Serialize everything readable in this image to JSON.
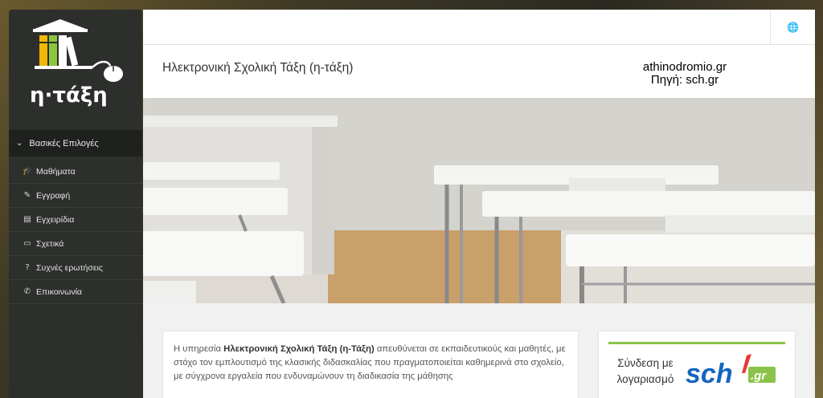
{
  "sidebar": {
    "logo_text": "η·τάξη",
    "menu_header": "Βασικές Επιλογές",
    "items": [
      {
        "label": "Μαθήματα",
        "icon": "graduation-cap-icon",
        "glyph": "🎓"
      },
      {
        "label": "Εγγραφή",
        "icon": "edit-icon",
        "glyph": "✎"
      },
      {
        "label": "Εγχειρίδια",
        "icon": "document-icon",
        "glyph": "▤"
      },
      {
        "label": "Σχετικά",
        "icon": "credit-card-icon",
        "glyph": "▭"
      },
      {
        "label": "Συχνές ερωτήσεις",
        "icon": "question-circle-icon",
        "glyph": "?"
      },
      {
        "label": "Επικοινωνία",
        "icon": "phone-icon",
        "glyph": "✆"
      }
    ]
  },
  "header": {
    "title": "Ηλεκτρονική Σχολική Τάξη (η-τάξη)",
    "watermark_line1": "athinodromio.gr",
    "watermark_line2": "Πηγή: sch.gr"
  },
  "info": {
    "pre": "Η υπηρεσία ",
    "bold": "Ηλεκτρονική Σχολική Τάξη (η-Τάξη)",
    "post": " απευθύνεται σε εκπαιδευτικούς και μαθητές, με στόχο τον εμπλουτισμό της κλασικής διδασκαλίας που πραγματοποιείται καθημερινά στο σχολείο, με σύγχρονα εργαλεία που ενδυναμώνουν τη διαδικασία της μάθησης"
  },
  "login": {
    "line1": "Σύνδεση με",
    "line2": "λογαριασμό",
    "logo_main": "sch",
    "logo_suffix": ".gr"
  },
  "colors": {
    "sidebar_bg": "#2c2f2c",
    "accent_green": "#8bc34a",
    "sch_blue": "#1565c0",
    "sch_red": "#e53935"
  }
}
